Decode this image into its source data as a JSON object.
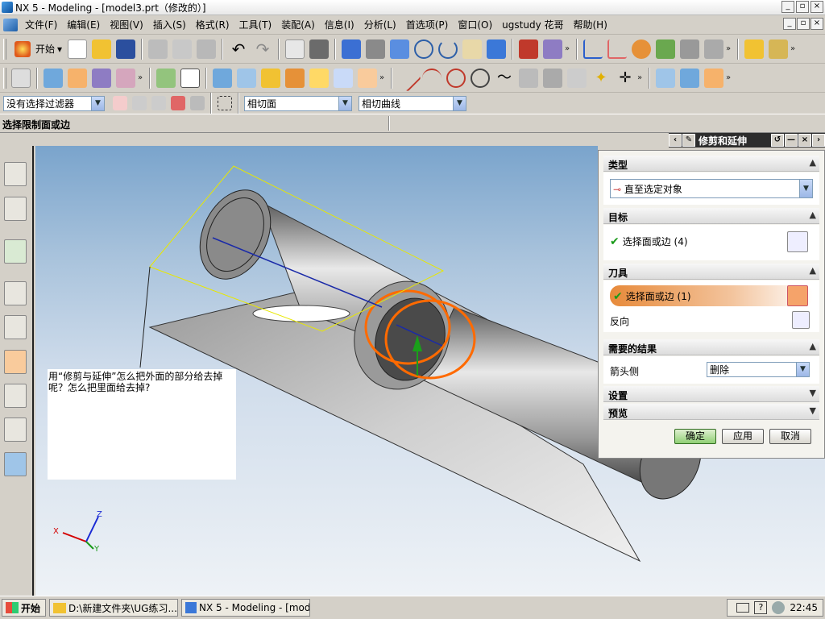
{
  "window": {
    "title": "NX 5 - Modeling - [model3.prt（修改的）]"
  },
  "menu": [
    "文件(F)",
    "编辑(E)",
    "视图(V)",
    "插入(S)",
    "格式(R)",
    "工具(T)",
    "装配(A)",
    "信息(I)",
    "分析(L)",
    "首选项(P)",
    "窗口(O)",
    "ugstudy 花哥",
    "帮助(H)"
  ],
  "toolbar": {
    "start_label": "开始",
    "more": "»"
  },
  "selection": {
    "filter": "没有选择过滤器",
    "face_rule": "相切面",
    "curve_rule": "相切曲线"
  },
  "cue": "选择限制面或边",
  "viewport": {
    "note": "用“修剪与延伸”怎么把外面的部分给去掉呢？怎么把里面给去掉?",
    "axes": {
      "x": "X",
      "y": "Y",
      "z": "Z"
    }
  },
  "dialog": {
    "title": "修剪和延伸",
    "sections": {
      "type": {
        "label": "类型",
        "value": "直至选定对象"
      },
      "target": {
        "label": "目标",
        "row": "选择面或边 (4)"
      },
      "tool": {
        "label": "刀具",
        "row": "选择面或边 (1)",
        "reverse": "反向"
      },
      "result": {
        "label": "需要的结果",
        "arrow_side": "箭头侧",
        "arrow_value": "删除"
      },
      "settings": {
        "label": "设置"
      },
      "preview": {
        "label": "预览"
      }
    },
    "buttons": {
      "ok": "确定",
      "apply": "应用",
      "cancel": "取消"
    }
  },
  "taskbar": {
    "start": "开始",
    "tasks": [
      "D:\\新建文件夹\\UG练习...",
      "NX 5 - Modeling - [model..."
    ],
    "time": "22:45"
  },
  "colors": {
    "ok_green": "#8fcf74",
    "highlight_orange": "#e78a3a",
    "viewport_top": "#7aa4cc"
  }
}
